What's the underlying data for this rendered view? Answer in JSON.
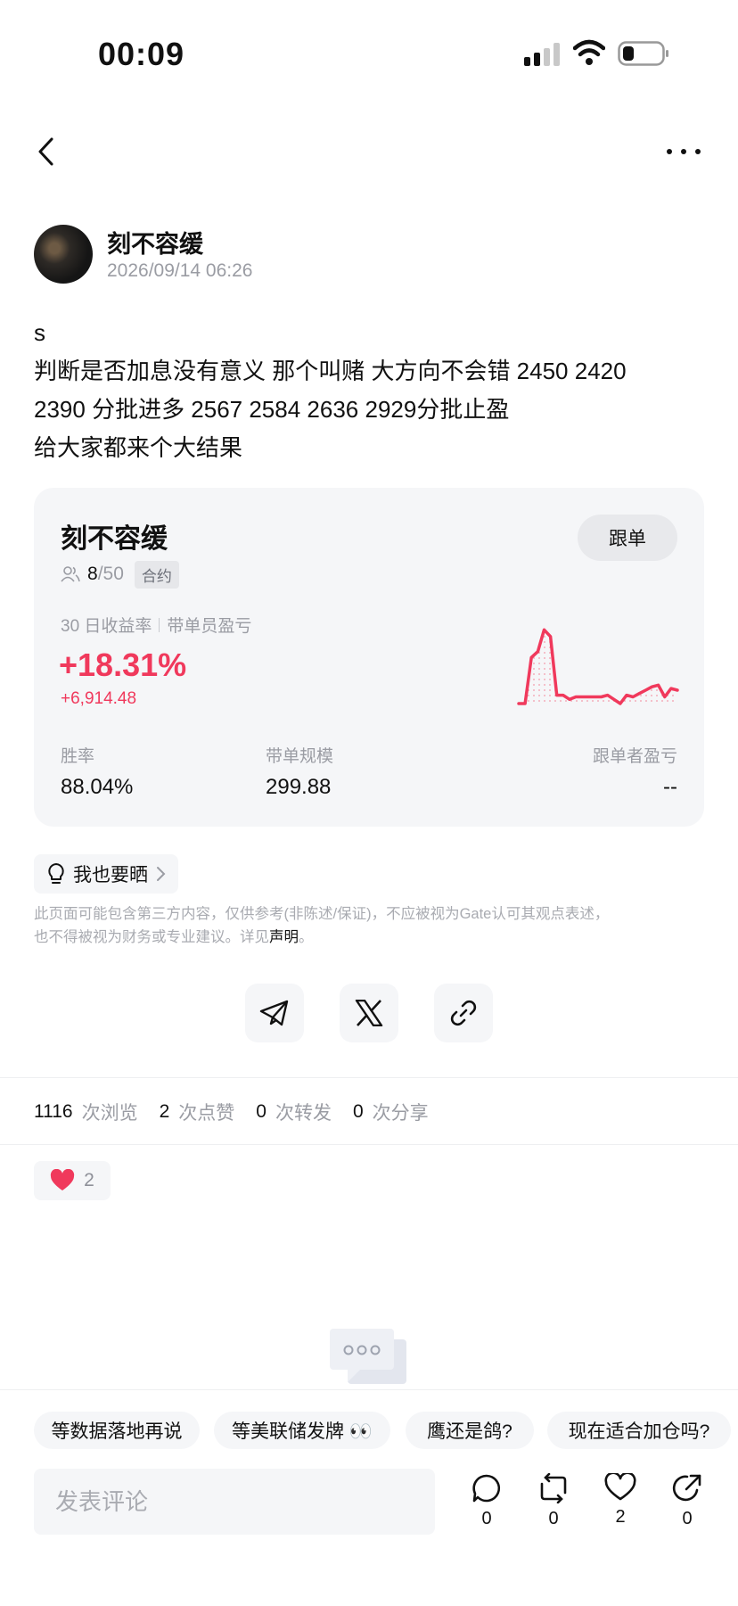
{
  "status_bar": {
    "time": "00:09"
  },
  "post": {
    "author": "刻不容缓",
    "timestamp": "2026/09/14 06:26",
    "body_lines": [
      "s",
      "判断是否加息没有意义 那个叫赌 大方向不会错 2450 2420",
      "2390 分批进多 2567 2584 2636 2929分批止盈",
      "给大家都来个大结果"
    ]
  },
  "trader_card": {
    "name": "刻不容缓",
    "follow_label": "跟单",
    "followers_current": "8",
    "followers_max": "/50",
    "contract_tag": "合约",
    "roi_label": "30 日收益率",
    "pnl_label": "带单员盈亏",
    "roi_value": "+18.31%",
    "pnl_value": "+6,914.48",
    "win_rate_label": "胜率",
    "win_rate_value": "88.04%",
    "scale_label": "带单规模",
    "scale_value": "299.88",
    "follower_pnl_label": "跟单者盈亏",
    "follower_pnl_value": "--",
    "accent_color": "#f0395c",
    "sparkline": [
      0.0,
      0.0,
      0.55,
      0.62,
      0.88,
      0.8,
      0.1,
      0.1,
      0.05,
      0.08,
      0.08,
      0.08,
      0.08,
      0.08,
      0.1,
      0.05,
      0.0,
      0.1,
      0.08,
      0.12,
      0.16,
      0.2,
      0.22,
      0.08,
      0.18,
      0.16
    ]
  },
  "show_button_label": "我也要晒",
  "disclaimer": {
    "line1": "此页面可能包含第三方内容，仅供参考(非陈述/保证)，不应被视为Gate认可其观点表述，",
    "line2_prefix": "也不得被视为财务或专业建议。详见",
    "link": "声明",
    "line2_suffix": "。"
  },
  "stats": {
    "views": "1116",
    "views_label": "次浏览",
    "likes": "2",
    "likes_label": "次点赞",
    "reposts": "0",
    "reposts_label": "次转发",
    "shares": "0",
    "shares_label": "次分享"
  },
  "reaction": {
    "count": "2"
  },
  "quick_replies": [
    "等数据落地再说",
    "等美联储发牌 👀",
    "鹰还是鸽?",
    "现在适合加仓吗?"
  ],
  "comment_placeholder": "发表评论",
  "actions": {
    "comments": "0",
    "reposts": "0",
    "likes": "2",
    "shares": "0"
  }
}
